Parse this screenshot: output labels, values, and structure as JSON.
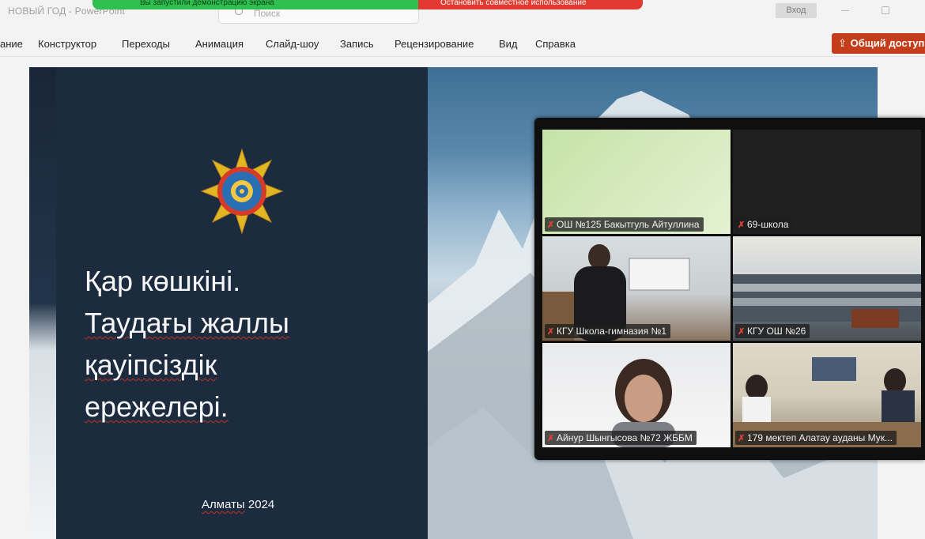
{
  "window": {
    "doc_title": "НОВЫЙ ГОД  -  PowerPoint",
    "screen_share_banner": "Вы запустили демонстрацию экрана",
    "stop_sharing_banner": "Остановить совместное использование",
    "search_placeholder": "Поиск",
    "signin_label": "Вход"
  },
  "ribbon": {
    "tabs": [
      "ание",
      "Конструктор",
      "Переходы",
      "Анимация",
      "Слайд-шоу",
      "Запись",
      "Рецензирование",
      "Вид",
      "Справка"
    ],
    "share_label": "Общий доступ"
  },
  "slide": {
    "title_lines": [
      "Қар көшкіні.",
      "Таудағы жаллы",
      "қауіпсіздік",
      "ережелері."
    ],
    "city": "Алматы",
    "year": "2024"
  },
  "video_tiles": [
    {
      "name": "ОШ №125 Бакытгуль Айтуллина",
      "muted": true
    },
    {
      "name": "69-школа",
      "muted": true
    },
    {
      "name": "КГУ Школа-гимназия №1",
      "muted": true
    },
    {
      "name": "КГУ ОШ №26",
      "muted": true
    },
    {
      "name": "Айнур Шынгысова №72 ЖББМ",
      "muted": true
    },
    {
      "name": "179 мектеп Алатау ауданы Мук...",
      "muted": true
    }
  ],
  "colors": {
    "share_accent": "#c43e1c",
    "slide_panel": "#1d2b3f",
    "screen_share_green": "#2fbf4e",
    "stop_share_red": "#e23a30"
  },
  "icons": [
    "search-icon",
    "share-icon",
    "muted-mic-icon",
    "minimize-icon",
    "maximize-icon",
    "emblem-icon"
  ]
}
